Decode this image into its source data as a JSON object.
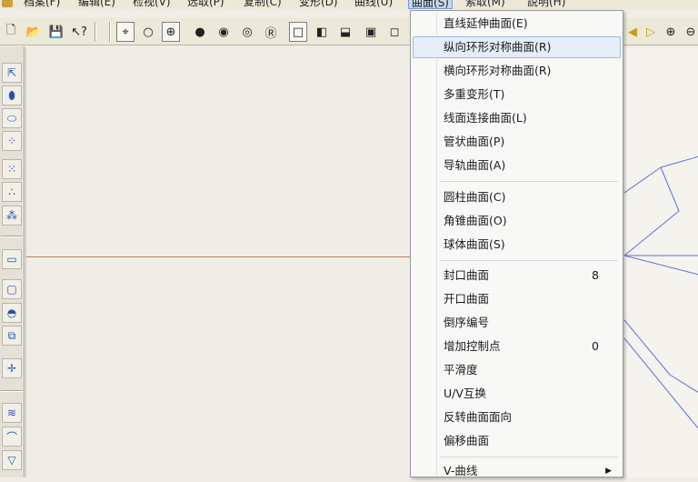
{
  "menubar": {
    "items": [
      "档案(F)",
      "编辑(E)",
      "检视(V)",
      "选取(P)",
      "复制(C)",
      "变形(D)",
      "曲线(U)",
      "曲面(S)",
      "索取(M)",
      "說明(H)"
    ]
  },
  "toolbar": {
    "buttons": [
      {
        "icon": "new-file-icon",
        "glyph": "🗋"
      },
      {
        "icon": "open-folder-icon",
        "glyph": "📂"
      },
      {
        "icon": "save-icon",
        "glyph": "💾"
      },
      {
        "icon": "help-pointer-icon",
        "glyph": "↖?"
      },
      {
        "icon": "point-snap-icon",
        "glyph": "⌖"
      },
      {
        "icon": "circle-icon",
        "glyph": "○"
      },
      {
        "icon": "target-icon",
        "glyph": "⊕"
      },
      {
        "icon": "filled-circle-icon",
        "glyph": "●"
      },
      {
        "icon": "gray-circle-icon",
        "glyph": "◉"
      },
      {
        "icon": "ring-circle-icon",
        "glyph": "◎"
      },
      {
        "icon": "r-circle-icon",
        "glyph": "Ⓡ"
      },
      {
        "icon": "square-icon",
        "glyph": "□"
      },
      {
        "icon": "half-square-left-icon",
        "glyph": "◧"
      },
      {
        "icon": "half-square-bottom-icon",
        "glyph": "⬓"
      },
      {
        "icon": "bold-square-icon",
        "glyph": "▣"
      },
      {
        "icon": "square-outline-icon",
        "glyph": "◻"
      },
      {
        "icon": "play-back-icon",
        "glyph": "◀"
      },
      {
        "icon": "play-forward-icon",
        "glyph": "▷"
      },
      {
        "icon": "zoom-in-icon",
        "glyph": "⊕"
      },
      {
        "icon": "zoom-out-icon",
        "glyph": "⊖"
      }
    ]
  },
  "left_toolbar": {
    "buttons": [
      {
        "icon": "select-arrow-icon",
        "glyph": "⇱"
      },
      {
        "icon": "dual-ellipse-icon",
        "glyph": "⬮"
      },
      {
        "icon": "stacked-ellipse-icon",
        "glyph": "⬭"
      },
      {
        "icon": "diagonal-points-icon",
        "glyph": "⁘"
      },
      {
        "icon": "point-grid-icon",
        "glyph": "⁙"
      },
      {
        "icon": "curve-points-icon",
        "glyph": "∴"
      },
      {
        "icon": "point-ring-icon",
        "glyph": "⁂"
      },
      {
        "icon": "small-rect-icon",
        "glyph": "▭"
      },
      {
        "icon": "rect-select-icon",
        "glyph": "▢"
      },
      {
        "icon": "half-circle-icon",
        "glyph": "◓"
      },
      {
        "icon": "copy-rect-icon",
        "glyph": "⧉"
      },
      {
        "icon": "move-point-icon",
        "glyph": "✛"
      },
      {
        "icon": "wave-surface-icon",
        "glyph": "≋"
      },
      {
        "icon": "arc-surface-icon",
        "glyph": "⌒"
      },
      {
        "icon": "triangle-down-icon",
        "glyph": "▽"
      }
    ]
  },
  "dropdown": {
    "items": [
      {
        "label": "直线延伸曲面(E)",
        "shortcut": "",
        "submenu": false
      },
      {
        "label": "纵向环形对称曲面(R)",
        "shortcut": "",
        "submenu": false,
        "hover": true
      },
      {
        "label": "横向环形对称曲面(R)",
        "shortcut": "",
        "submenu": false
      },
      {
        "label": "多重变形(T)",
        "shortcut": "",
        "submenu": false
      },
      {
        "label": "线面连接曲面(L)",
        "shortcut": "",
        "submenu": false
      },
      {
        "label": "管状曲面(P)",
        "shortcut": "",
        "submenu": false
      },
      {
        "label": "导轨曲面(A)",
        "shortcut": "",
        "submenu": false
      },
      {
        "label": "圆柱曲面(C)",
        "shortcut": "",
        "submenu": false
      },
      {
        "label": "角锥曲面(O)",
        "shortcut": "",
        "submenu": false
      },
      {
        "label": "球体曲面(S)",
        "shortcut": "",
        "submenu": false
      },
      {
        "label": "封口曲面",
        "shortcut": "8",
        "submenu": false
      },
      {
        "label": "开口曲面",
        "shortcut": "",
        "submenu": false
      },
      {
        "label": "倒序编号",
        "shortcut": "",
        "submenu": false
      },
      {
        "label": "增加控制点",
        "shortcut": "0",
        "submenu": false
      },
      {
        "label": "平滑度",
        "shortcut": "",
        "submenu": false
      },
      {
        "label": "U/V互换",
        "shortcut": "",
        "submenu": false
      },
      {
        "label": "反转曲面面向",
        "shortcut": "",
        "submenu": false
      },
      {
        "label": "偏移曲面",
        "shortcut": "",
        "submenu": false
      },
      {
        "label": "V-曲线",
        "shortcut": "",
        "submenu": true
      }
    ]
  },
  "colors": {
    "canvas": "#f0ede6",
    "guide_line": "#b87d63",
    "wireframe": "#5f6fd8",
    "menu_hover": "#e4edf8"
  }
}
